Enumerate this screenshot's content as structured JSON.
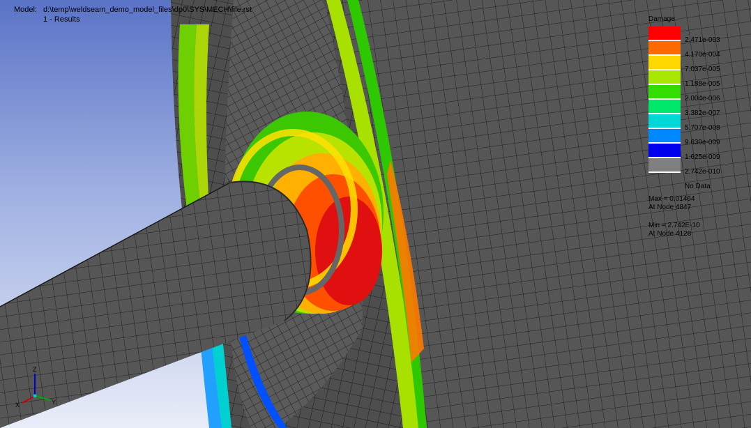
{
  "header": {
    "model_label": "Model:",
    "model_path": "d:\\temp\\weldseam_demo_model_files\\dp0\\SYS\\MECH\\file.rst",
    "results_label": "1 - Results"
  },
  "legend": {
    "title": "Damage",
    "colors": [
      "#ff0000",
      "#ff6a00",
      "#ffd800",
      "#a8e800",
      "#33dd00",
      "#00e86a",
      "#00d8d8",
      "#0088ff",
      "#0000ee",
      "#808080"
    ],
    "ticks": [
      "2.471e-003",
      "4.170e-004",
      "7.037e-005",
      "1.188e-005",
      "2.004e-006",
      "3.382e-007",
      "5.707e-008",
      "9.630e-009",
      "1.625e-009",
      "2.742e-010",
      "No Data"
    ],
    "max_line1": "Max = 0.01464",
    "max_line2": "At Node 4847",
    "min_line1": "Min = 2.742E-10",
    "min_line2": "At Node 4128"
  },
  "triad": {
    "z_label": "Z",
    "y_label": "Y",
    "x_label": "X",
    "z_color": "#0000cc",
    "y_color": "#00aa00",
    "x_color": "#cc0000"
  }
}
